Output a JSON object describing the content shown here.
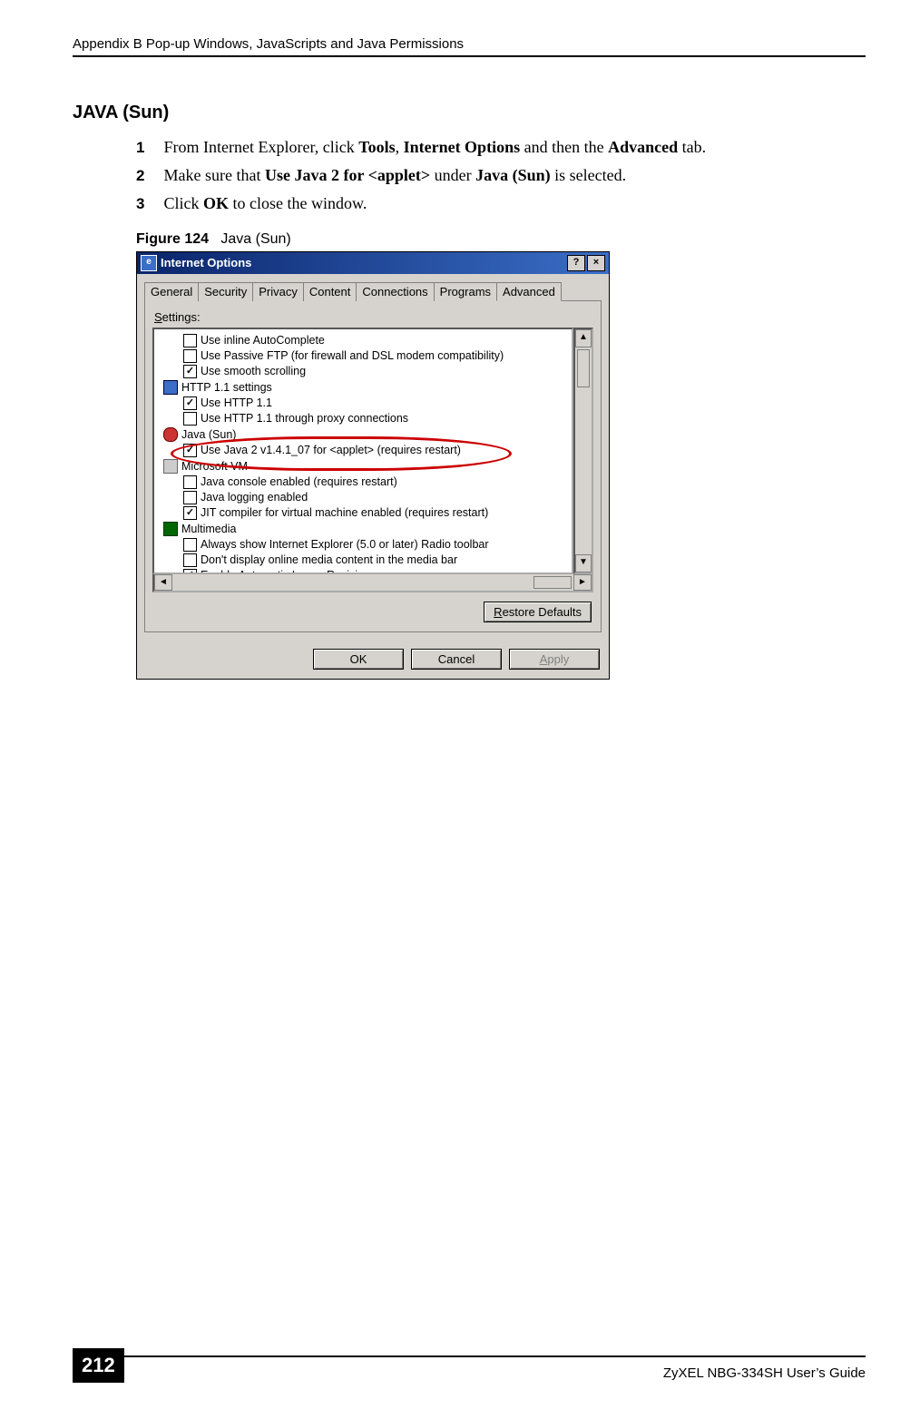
{
  "header": "Appendix B Pop-up Windows, JavaScripts and Java Permissions",
  "section_title": "JAVA (Sun)",
  "steps": [
    {
      "num": "1",
      "pre": "From Internet Explorer, click ",
      "b1": "Tools",
      "mid1": ", ",
      "b2": "Internet Options",
      "mid2": " and then the ",
      "b3": "Advanced",
      "post": " tab."
    },
    {
      "num": "2",
      "pre": "Make sure that ",
      "b1": "Use Java 2 for <applet>",
      "mid1": " under ",
      "b2": "Java (Sun)",
      "mid2": " is selected.",
      "b3": "",
      "post": ""
    },
    {
      "num": "3",
      "pre": "Click ",
      "b1": "OK",
      "mid1": " to close the window.",
      "b2": "",
      "mid2": "",
      "b3": "",
      "post": ""
    }
  ],
  "figure": {
    "label": "Figure 124",
    "caption": "Java (Sun)"
  },
  "dialog": {
    "title": "Internet Options",
    "help_btn": "?",
    "close_btn": "×",
    "tabs": [
      "General",
      "Security",
      "Privacy",
      "Content",
      "Connections",
      "Programs",
      "Advanced"
    ],
    "active_tab_index": 6,
    "settings_label_pre": "S",
    "settings_label_post": "ettings:",
    "tree": [
      {
        "indent": 1,
        "type": "cb",
        "checked": false,
        "label": "Use inline AutoComplete"
      },
      {
        "indent": 1,
        "type": "cb",
        "checked": false,
        "label": "Use Passive FTP (for firewall and DSL modem compatibility)"
      },
      {
        "indent": 1,
        "type": "cb",
        "checked": true,
        "label": "Use smooth scrolling"
      },
      {
        "indent": 0,
        "type": "node",
        "icon": "ie",
        "label": "HTTP 1.1 settings"
      },
      {
        "indent": 1,
        "type": "cb",
        "checked": true,
        "label": "Use HTTP 1.1"
      },
      {
        "indent": 1,
        "type": "cb",
        "checked": false,
        "label": "Use HTTP 1.1 through proxy connections"
      },
      {
        "indent": 0,
        "type": "node",
        "icon": "java",
        "label": "Java (Sun)"
      },
      {
        "indent": 1,
        "type": "cb",
        "checked": true,
        "label": "Use Java 2 v1.4.1_07 for <applet> (requires restart)"
      },
      {
        "indent": 0,
        "type": "node",
        "icon": "vm",
        "label": "Microsoft VM"
      },
      {
        "indent": 1,
        "type": "cb",
        "checked": false,
        "label": "Java console enabled (requires restart)"
      },
      {
        "indent": 1,
        "type": "cb",
        "checked": false,
        "label": "Java logging enabled"
      },
      {
        "indent": 1,
        "type": "cb",
        "checked": true,
        "label": "JIT compiler for virtual machine enabled (requires restart)"
      },
      {
        "indent": 0,
        "type": "node",
        "icon": "mm",
        "label": "Multimedia"
      },
      {
        "indent": 1,
        "type": "cb",
        "checked": false,
        "label": "Always show Internet Explorer (5.0 or later) Radio toolbar"
      },
      {
        "indent": 1,
        "type": "cb",
        "checked": false,
        "label": "Don't display online media content in the media bar"
      },
      {
        "indent": 1,
        "type": "cb",
        "checked": true,
        "label": "Enable Automatic Image Resizing"
      }
    ],
    "restore_pre": "R",
    "restore_post": "estore Defaults",
    "ok": "OK",
    "cancel": "Cancel",
    "apply_pre": "A",
    "apply_post": "pply"
  },
  "footer": {
    "page": "212",
    "guide": "ZyXEL NBG-334SH User’s Guide"
  }
}
